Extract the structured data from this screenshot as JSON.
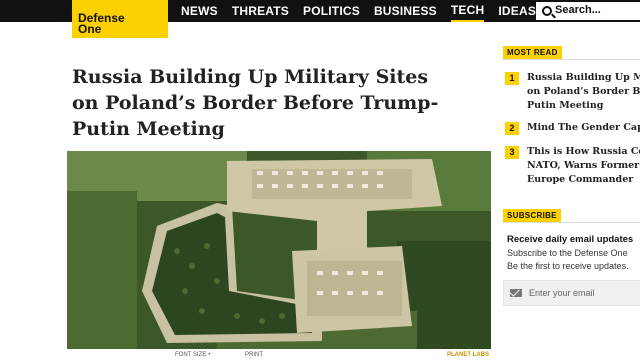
{
  "brand": {
    "line1": "Defense",
    "line2": "One"
  },
  "nav": [
    {
      "label": "NEWS"
    },
    {
      "label": "THREATS"
    },
    {
      "label": "POLITICS"
    },
    {
      "label": "BUSINESS"
    },
    {
      "label": "TECH"
    },
    {
      "label": "IDEAS"
    }
  ],
  "search": {
    "placeholder": "Search..."
  },
  "article": {
    "headline": "Russia Building Up Military Sites on Poland’s Border Before Trump-Putin Meeting",
    "toolbar": {
      "font_size": "FONT SIZE +",
      "print": "PRINT",
      "credit": "PLANET LABS"
    }
  },
  "most_read": {
    "label": "MOST READ",
    "items": [
      {
        "num": "1",
        "lines": [
          "Russia Building Up Mi",
          "on Poland’s Border Be",
          "Putin Meeting"
        ]
      },
      {
        "num": "2",
        "lines": [
          "Mind The Gender Capa"
        ]
      },
      {
        "num": "3",
        "lines": [
          "This is How Russia Co",
          "NATO, Warns Former",
          "Europe Commander"
        ]
      }
    ]
  },
  "subscribe": {
    "label": "SUBSCRIBE",
    "title": "Receive daily email updates",
    "desc_lines": [
      "Subscribe to the Defense One",
      "Be the first to receive updates."
    ],
    "email_placeholder": "Enter your email"
  },
  "colors": {
    "accent": "#fdd000",
    "topbar": "#111111"
  }
}
